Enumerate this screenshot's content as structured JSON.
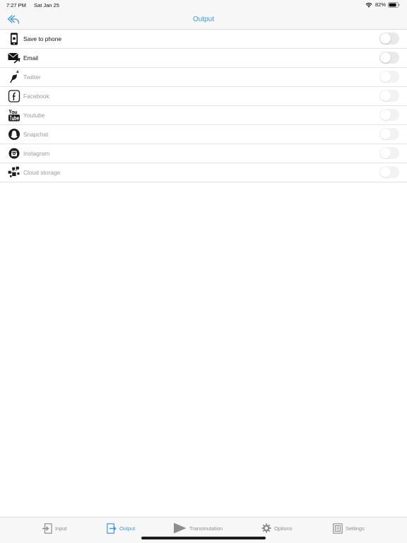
{
  "status_bar": {
    "time": "7:27 PM",
    "date": "Sat Jan 25",
    "battery": "82%"
  },
  "nav": {
    "title": "Output",
    "back_icon": "reply-arrow-icon"
  },
  "colors": {
    "accent": "#3f97e3",
    "disabled_text": "#9a9a9a",
    "toggle_off": "#e9e9ea"
  },
  "outputs": [
    {
      "label": "Save to phone",
      "icon": "phone-icon",
      "enabled": true,
      "on": false
    },
    {
      "label": "Email",
      "icon": "email-icon",
      "enabled": true,
      "on": false
    },
    {
      "label": "Twitter",
      "icon": "twitter-icon",
      "enabled": false,
      "on": false
    },
    {
      "label": "Facebook",
      "icon": "facebook-icon",
      "enabled": false,
      "on": false
    },
    {
      "label": "Youtube",
      "icon": "youtube-icon",
      "enabled": false,
      "on": false
    },
    {
      "label": "Snapchat",
      "icon": "snapchat-icon",
      "enabled": false,
      "on": false
    },
    {
      "label": "Instagram",
      "icon": "instagram-icon",
      "enabled": false,
      "on": false
    },
    {
      "label": "Cloud storage",
      "icon": "cloud-storage-icon",
      "enabled": false,
      "on": false
    }
  ],
  "tabs": [
    {
      "label": "Input",
      "icon": "input-icon",
      "active": false
    },
    {
      "label": "Output",
      "icon": "output-icon",
      "active": true
    },
    {
      "label": "Transmutation",
      "icon": "play-icon",
      "active": false
    },
    {
      "label": "Options",
      "icon": "gear-icon",
      "active": false
    },
    {
      "label": "Settings",
      "icon": "settings-icon",
      "active": false
    }
  ]
}
